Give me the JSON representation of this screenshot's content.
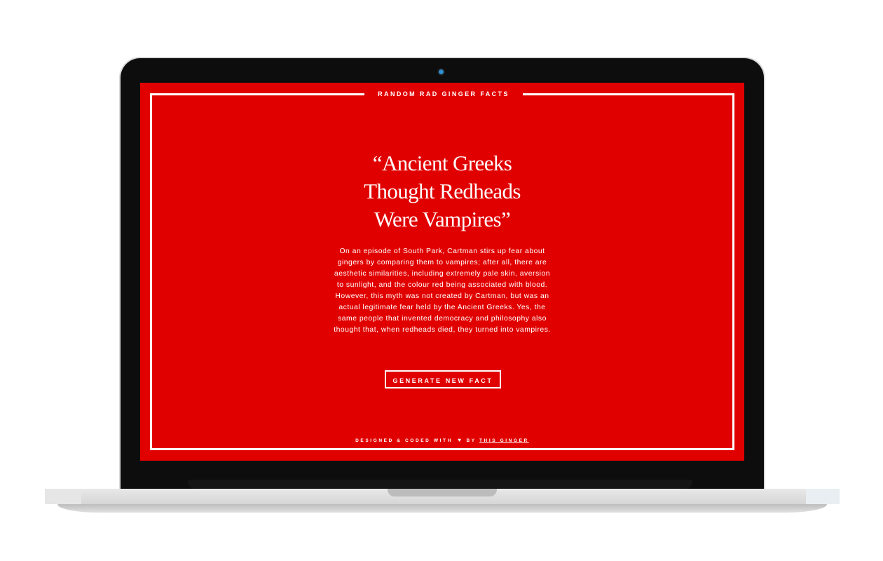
{
  "site": {
    "top_label": "RANDOM RAD GINGER FACTS",
    "headline_lines": [
      "“Ancient Greeks",
      "Thought Redheads",
      "Were Vampires”"
    ],
    "body": "On an episode of South Park, Cartman stirs up fear about gingers by comparing them to vampires; after all, there are aesthetic similarities, including extremely pale skin, aversion to sunlight, and the colour red being associated with blood. However, this myth was not created by Cartman, but was an actual legitimate fear held by the Ancient Greeks. Yes, the same people that invented democracy and philosophy also thought that, when redheads died, they turned into vampires.",
    "generate_button": "GENERATE NEW FACT",
    "footer_prefix": "DESIGNED & CODED WITH",
    "footer_heart": "♥",
    "footer_by": "BY",
    "footer_link": "THIS GINGER"
  },
  "colors": {
    "screen_red": "#e10000",
    "text": "#ffffff",
    "camera": "#2f8fd0"
  },
  "icons": {
    "heart": "heart-icon"
  }
}
